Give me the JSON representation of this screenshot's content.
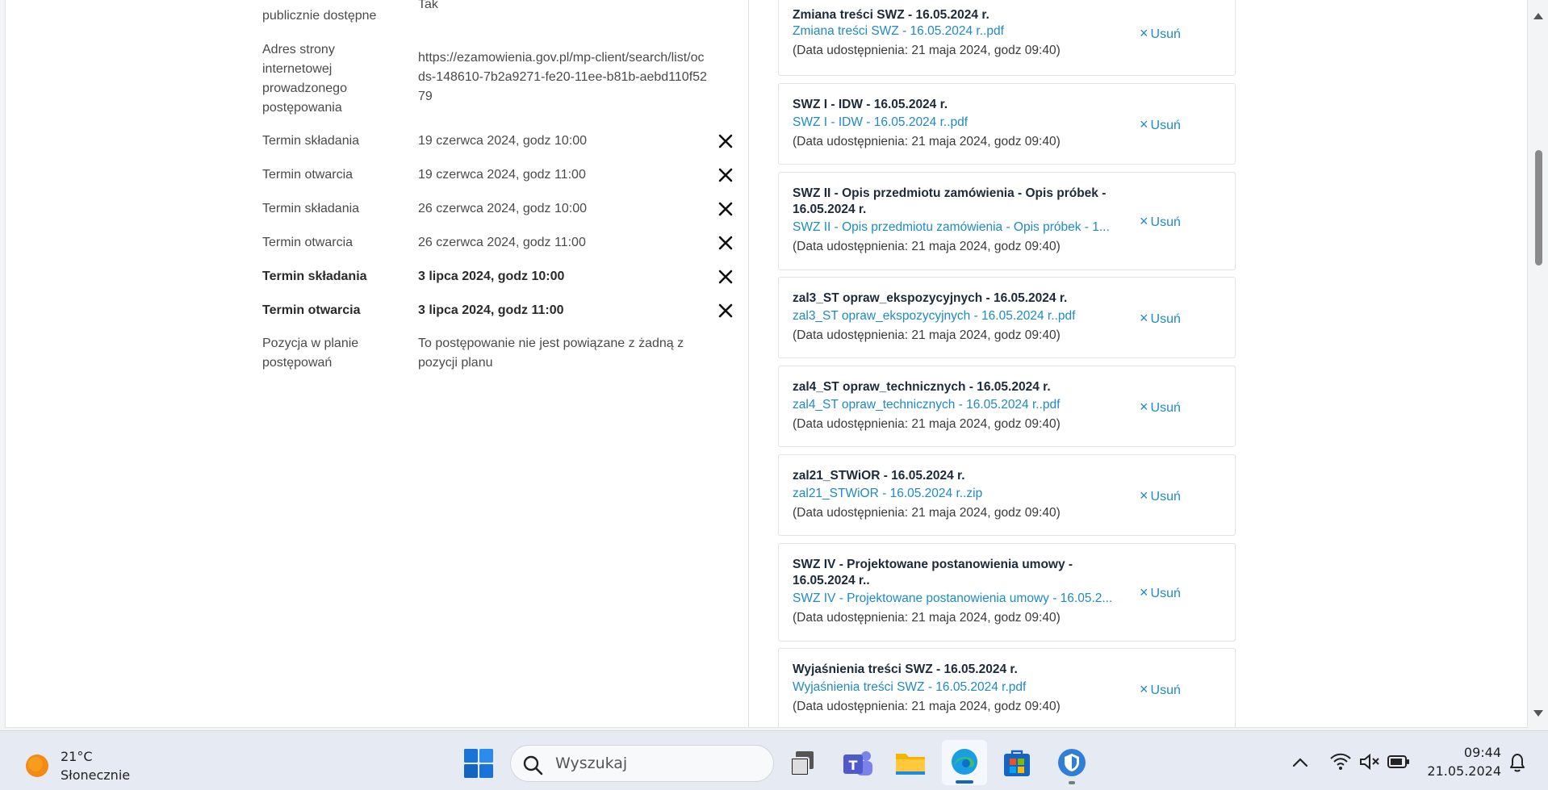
{
  "details": {
    "top_label": "publicznie dostępne",
    "top_value": "Tak",
    "rows": [
      {
        "label": "Adres strony internetowej prowadzonego postępowania",
        "value": "https://ezamowienia.gov.pl/mp-client/search/list/ocds-148610-7b2a9271-fe20-11ee-b81b-aebd110f5279"
      },
      {
        "label": "Termin składania",
        "value": "19 czerwca 2024, godz 10:00"
      },
      {
        "label": "Termin otwarcia",
        "value": "19 czerwca 2024, godz 11:00"
      },
      {
        "label": "Termin składania",
        "value": "26 czerwca 2024, godz 10:00"
      },
      {
        "label": "Termin otwarcia",
        "value": "26 czerwca 2024, godz 11:00"
      },
      {
        "label": "Termin składania",
        "value": "3 lipca 2024, godz 10:00"
      },
      {
        "label": "Termin otwarcia",
        "value": "3 lipca 2024, godz 11:00"
      },
      {
        "label": "Pozycja w planie postępowań",
        "value": "To postępowanie nie jest powiązane z żadną z pozycji planu"
      }
    ]
  },
  "documents": {
    "delete_label": "Usuń",
    "items": [
      {
        "title": "Zmiana treści SWZ - 16.05.2024 r.",
        "file": "Zmiana treści SWZ - 16.05.2024 r..pdf",
        "date": "(Data udostępnienia: 21 maja 2024, godz 09:40)"
      },
      {
        "title": "SWZ I - IDW - 16.05.2024 r.",
        "file": "SWZ I - IDW - 16.05.2024 r..pdf",
        "date": "(Data udostępnienia: 21 maja 2024, godz 09:40)"
      },
      {
        "title": "SWZ II - Opis przedmiotu zamówienia - Opis próbek - 16.05.2024 r.",
        "file": "SWZ II - Opis przedmiotu zamówienia - Opis próbek - 1...",
        "date": "(Data udostępnienia: 21 maja 2024, godz 09:40)"
      },
      {
        "title": "zal3_ST opraw_ekspozycyjnych - 16.05.2024 r.",
        "file": "zal3_ST opraw_ekspozycyjnych - 16.05.2024 r..pdf",
        "date": "(Data udostępnienia: 21 maja 2024, godz 09:40)"
      },
      {
        "title": "zal4_ST opraw_technicznych - 16.05.2024 r.",
        "file": "zal4_ST opraw_technicznych - 16.05.2024 r..pdf",
        "date": "(Data udostępnienia: 21 maja 2024, godz 09:40)"
      },
      {
        "title": "zal21_STWiOR - 16.05.2024 r.",
        "file": "zal21_STWiOR - 16.05.2024 r..zip",
        "date": "(Data udostępnienia: 21 maja 2024, godz 09:40)"
      },
      {
        "title": "SWZ IV - Projektowane postanowienia umowy - 16.05.2024 r..",
        "file": "SWZ IV - Projektowane postanowienia umowy - 16.05.2...",
        "date": "(Data udostępnienia: 21 maja 2024, godz 09:40)"
      },
      {
        "title": "Wyjaśnienia treści SWZ - 16.05.2024 r.",
        "file": "Wyjaśnienia treści SWZ - 16.05.2024 r.pdf",
        "date": "(Data udostępnienia: 21 maja 2024, godz 09:40)"
      }
    ]
  },
  "taskbar": {
    "weather_temp": "21°C",
    "weather_desc": "Słonecznie",
    "search_placeholder": "Wyszukaj",
    "time": "09:44",
    "date": "21.05.2024"
  }
}
